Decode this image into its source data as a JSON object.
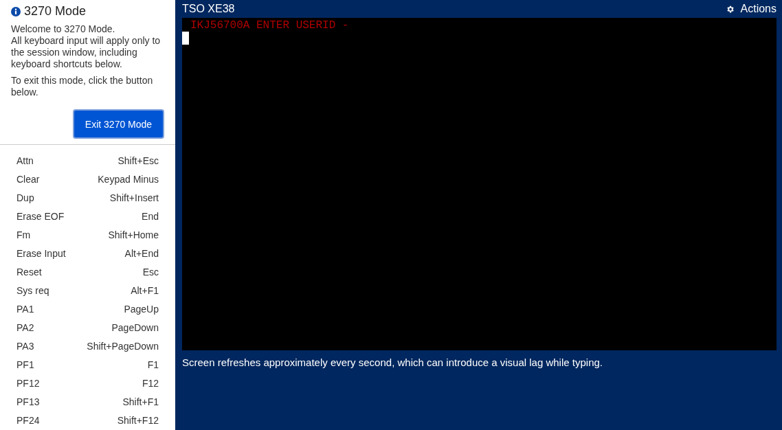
{
  "sidebar": {
    "title": "3270 Mode",
    "intro": [
      "Welcome to 3270 Mode.",
      "All keyboard input will apply only to the session window, including keyboard shortcuts below."
    ],
    "exit_hint": "To exit this mode, click the button below.",
    "exit_button": "Exit 3270 Mode",
    "shortcuts": [
      {
        "action": "Attn",
        "keys": "Shift+Esc"
      },
      {
        "action": "Clear",
        "keys": "Keypad Minus"
      },
      {
        "action": "Dup",
        "keys": "Shift+Insert"
      },
      {
        "action": "Erase EOF",
        "keys": "End"
      },
      {
        "action": "Fm",
        "keys": "Shift+Home"
      },
      {
        "action": "Erase Input",
        "keys": "Alt+End"
      },
      {
        "action": "Reset",
        "keys": "Esc"
      },
      {
        "action": "Sys req",
        "keys": "Alt+F1"
      },
      {
        "action": "PA1",
        "keys": "PageUp"
      },
      {
        "action": "PA2",
        "keys": "PageDown"
      },
      {
        "action": "PA3",
        "keys": "Shift+PageDown"
      },
      {
        "action": "PF1",
        "keys": "F1"
      },
      {
        "action": "PF12",
        "keys": "F12"
      },
      {
        "action": "PF13",
        "keys": "Shift+F1"
      },
      {
        "action": "PF24",
        "keys": "Shift+F12"
      }
    ]
  },
  "session": {
    "title": "TSO XE38",
    "actions_button": "Actions",
    "terminal_lines": [
      "IKJ56700A ENTER USERID -"
    ],
    "note": "Screen refreshes approximately every second, which can introduce a visual lag while typing."
  }
}
